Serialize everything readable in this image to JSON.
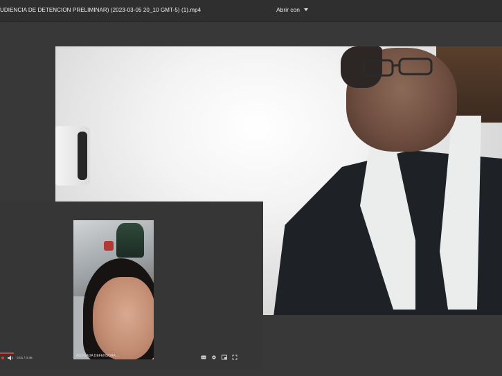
{
  "window": {
    "title": "UDIENCIA DE DETENCION PRELIMINAR) (2023-03-05 20_10 GMT-5) (1).mp4",
    "open_with_label": "Abrir con"
  },
  "player": {
    "time": "0:01 / 0:46",
    "phone_caption": "ABOGADA DEFENSORA ..."
  },
  "icons": [
    "chevron-down-icon",
    "volume-icon",
    "captions-icon",
    "settings-icon",
    "miniplayer-icon",
    "fullscreen-icon"
  ],
  "colors": {
    "topbar": "#2f2f2f",
    "background": "#383838",
    "progress": "#e53935"
  }
}
